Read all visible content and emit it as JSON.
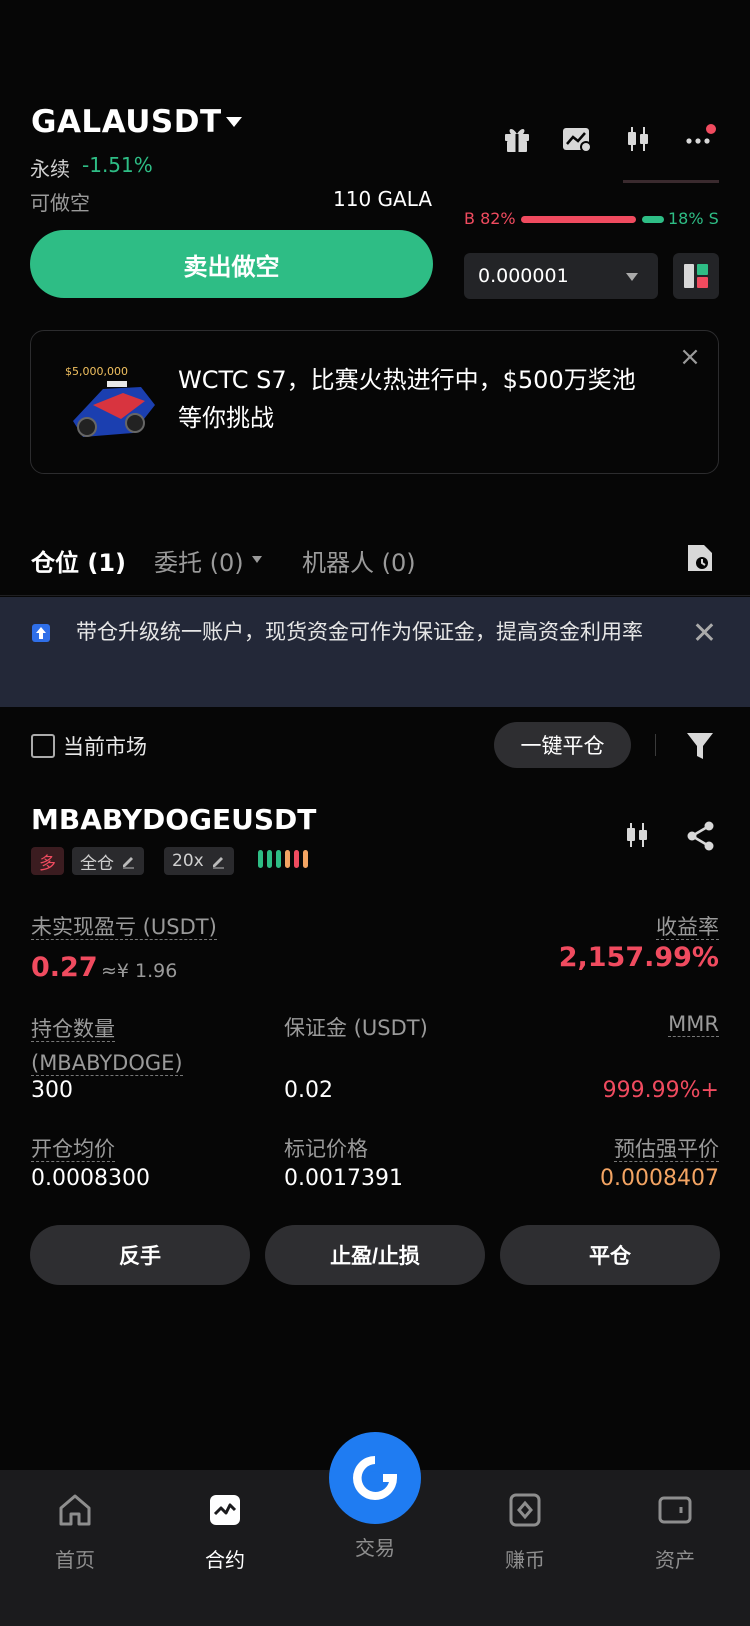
{
  "header": {
    "pair": "GALAUSDT",
    "contract_type": "永续",
    "change": "-1.51%",
    "can_short_label": "可做空",
    "can_short_amount": "110 GALA",
    "sell_button": "卖出做空",
    "ratio_buy": "B 82%",
    "ratio_sell": "18% S",
    "ratio_buy_fraction": 0.82,
    "precision": "0.000001"
  },
  "promo": {
    "text": "WCTC S7，比赛火热进行中，$500万奖池等你挑战",
    "image_caption": "$5,000,000"
  },
  "tabs": [
    {
      "label": "仓位 (1)"
    },
    {
      "label": "委托 (0)"
    },
    {
      "label": "机器人 (0)"
    }
  ],
  "banner": {
    "text": "带仓升级统一账户，现货资金可作为保证金，提高资金利用率"
  },
  "filter": {
    "current_market": "当前市场",
    "close_all": "一键平仓"
  },
  "position": {
    "symbol": "MBABYDOGEUSDT",
    "side": "多",
    "margin_mode": "全仓",
    "leverage": "20x",
    "unrealized_pnl_label": "未实现盈亏 (USDT)",
    "unrealized_pnl": "0.27",
    "unrealized_pnl_cny": "≈¥ 1.96",
    "roi_label": "收益率",
    "roi": "2,157.99%",
    "qty_label": "持仓数量 (MBABYDOGE)",
    "qty": "300",
    "margin_label": "保证金 (USDT)",
    "margin": "0.02",
    "mmr_label": "MMR",
    "mmr": "999.99%+",
    "entry_label": "开仓均价",
    "entry": "0.0008300",
    "mark_label": "标记价格",
    "mark": "0.0017391",
    "liq_label": "预估强平价",
    "liq": "0.0008407",
    "actions": {
      "reverse": "反手",
      "tpsl": "止盈/止损",
      "close": "平仓"
    }
  },
  "nav": {
    "home": "首页",
    "contract": "合约",
    "trade": "交易",
    "earn": "赚币",
    "assets": "资产"
  },
  "colors": {
    "green": "#2ebd85",
    "red": "#f04b5f",
    "orange": "#f3a463",
    "blue": "#1f7cf2"
  }
}
